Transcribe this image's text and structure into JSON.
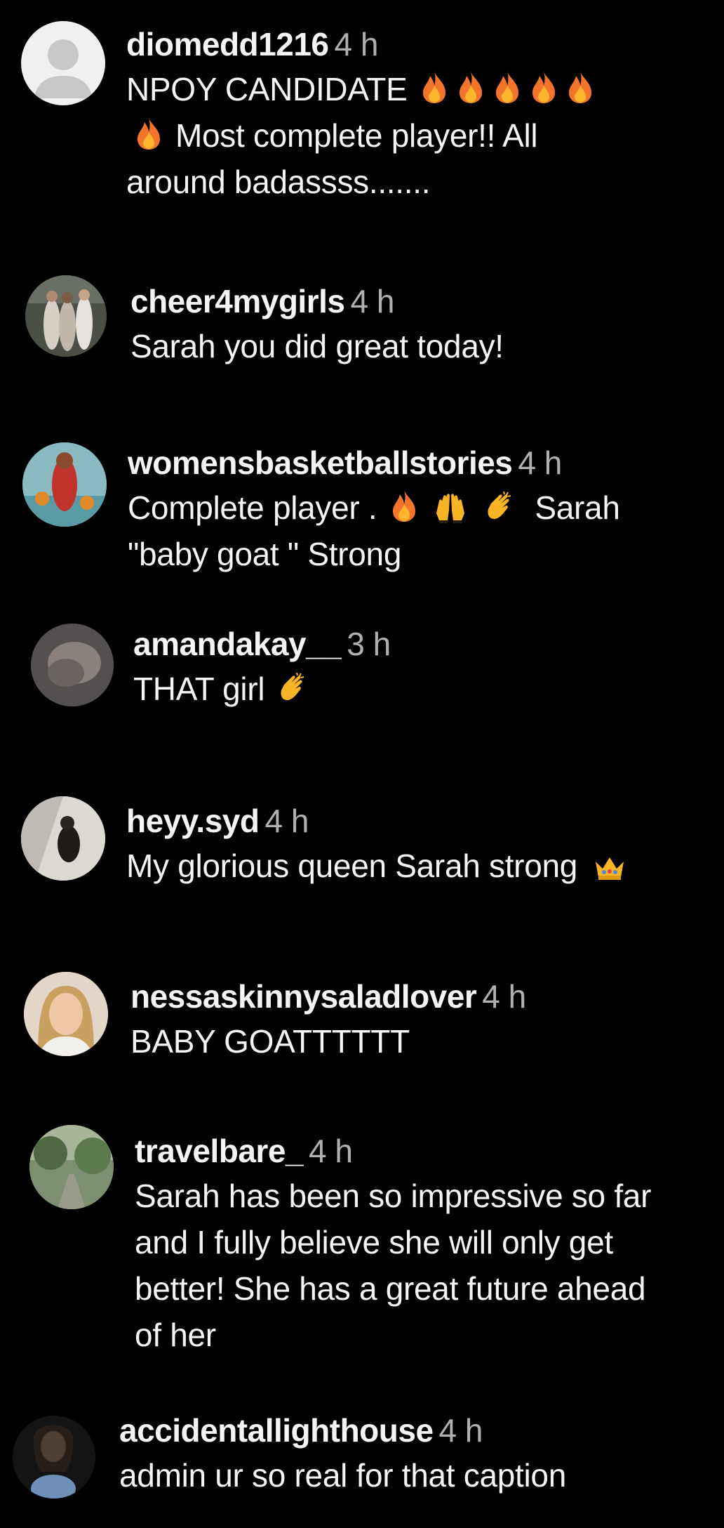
{
  "comments": [
    {
      "username": "diomedd1216",
      "time": "4 h",
      "line1": "NPOY CANDIDATE",
      "line2": "Most complete player!! All",
      "line3": "around badassss......."
    },
    {
      "username": "cheer4mygirls",
      "time": "4 h",
      "text": "Sarah you did great today!"
    },
    {
      "username": "womensbasketballstories",
      "time": "4 h",
      "line1a": "Complete player .",
      "line1b": "Sarah",
      "line2": "\"baby goat \" Strong"
    },
    {
      "username": "amandakay__",
      "time": "3 h",
      "text": "THAT girl"
    },
    {
      "username": "heyy.syd",
      "time": "4 h",
      "text": "My glorious queen Sarah strong"
    },
    {
      "username": "nessaskinnysaladlover",
      "time": "4 h",
      "text": "BABY GOATTTTTT"
    },
    {
      "username": "travelbare_",
      "time": "4 h",
      "line1": "Sarah has been so impressive so far",
      "line2": "and I fully believe she will only get",
      "line3": "better! She has a great future ahead",
      "line4": "of her"
    },
    {
      "username": "accidentallighthouse",
      "time": "4 h",
      "text": "admin ur so real for that caption"
    }
  ],
  "icons": {
    "fire": "fire-icon",
    "raised_hands": "raised-hands-icon",
    "clap": "clapping-hands-icon",
    "crown": "crown-icon",
    "default_avatar": "default-avatar-icon"
  },
  "colors": {
    "background": "#000000",
    "username": "#f4f4f4",
    "timestamp": "#b0b0b0",
    "fire": "#f4742b"
  }
}
